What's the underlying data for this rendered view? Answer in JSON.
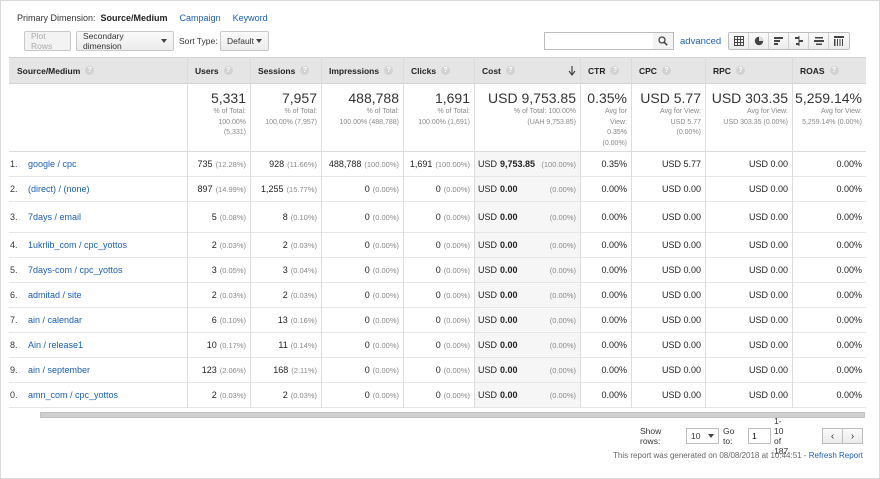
{
  "dimensions": {
    "label": "Primary Dimension:",
    "current": "Source/Medium",
    "links": [
      "Campaign",
      "Keyword"
    ]
  },
  "toolbar": {
    "plot_rows": "Plot Rows",
    "secondary_dimension": "Secondary dimension",
    "sort_type_label": "Sort Type:",
    "sort_type_value": "Default",
    "advanced": "advanced",
    "search_placeholder": ""
  },
  "columns": {
    "source": "Source/Medium",
    "users": "Users",
    "sessions": "Sessions",
    "impressions": "Impressions",
    "clicks": "Clicks",
    "cost": "Cost",
    "ctr": "CTR",
    "cpc": "CPC",
    "rpc": "RPC",
    "roas": "ROAS"
  },
  "totals": {
    "users": {
      "value": "5,331",
      "sub1": "% of Total:",
      "sub2": "100.00%",
      "sub3": "(5,331)"
    },
    "sessions": {
      "value": "7,957",
      "sub1": "% of Total:",
      "sub2": "100.00% (7,957)",
      "sub3": ""
    },
    "impressions": {
      "value": "488,788",
      "sub1": "% of Total:",
      "sub2": "100.00% (488,788)",
      "sub3": ""
    },
    "clicks": {
      "value": "1,691",
      "sub1": "% of Total:",
      "sub2": "100.00% (1,691)",
      "sub3": ""
    },
    "cost": {
      "value": "USD 9,753.85",
      "sub1": "% of Total: 100.00%",
      "sub2": "(UAH 9,753.85)",
      "sub3": ""
    },
    "ctr": {
      "value": "0.35%",
      "sub1": "Avg for",
      "sub2": "View:",
      "sub3": "0.35%",
      "sub4": "(0.00%)"
    },
    "cpc": {
      "value": "USD 5.77",
      "sub1": "Avg for View:",
      "sub2": "USD 5.77",
      "sub3": "(0.00%)"
    },
    "rpc": {
      "value": "USD 303.35",
      "sub1": "Avg for View:",
      "sub2": "USD 303.35 (0.00%)",
      "sub3": ""
    },
    "roas": {
      "value": "5,259.14%",
      "sub1": "Avg for View:",
      "sub2": "5,259.14% (0.00%)",
      "sub3": ""
    }
  },
  "rows": [
    {
      "idx": "1.",
      "source": "google / cpc",
      "users": "735",
      "users_pct": "(12.28%)",
      "sessions": "928",
      "sessions_pct": "(11.66%)",
      "impressions": "488,788",
      "impressions_pct": "(100.00%)",
      "clicks": "1,691",
      "clicks_pct": "(100.00%)",
      "cost_cur": "USD",
      "cost": "9,753.85",
      "cost_pct": "(100.00%)",
      "ctr": "0.35%",
      "cpc": "USD 5.77",
      "rpc": "USD 0.00",
      "roas": "0.00%"
    },
    {
      "idx": "2.",
      "source": "(direct) / (none)",
      "users": "897",
      "users_pct": "(14.99%)",
      "sessions": "1,255",
      "sessions_pct": "(15.77%)",
      "impressions": "0",
      "impressions_pct": "(0.00%)",
      "clicks": "0",
      "clicks_pct": "(0.00%)",
      "cost_cur": "USD",
      "cost": "0.00",
      "cost_pct": "(0.00%)",
      "ctr": "0.00%",
      "cpc": "USD 0.00",
      "rpc": "USD 0.00",
      "roas": "0.00%"
    },
    {
      "idx": "3.",
      "source": "7days / email",
      "users": "5",
      "users_pct": "(0.08%)",
      "sessions": "8",
      "sessions_pct": "(0.10%)",
      "impressions": "0",
      "impressions_pct": "(0.00%)",
      "clicks": "0",
      "clicks_pct": "(0.00%)",
      "cost_cur": "USD",
      "cost": "0.00",
      "cost_pct": "(0.00%)",
      "ctr": "0.00%",
      "cpc": "USD 0.00",
      "rpc": "USD 0.00",
      "roas": "0.00%"
    },
    {
      "idx": "4.",
      "source": "1ukrlib_com / cpc_yottos",
      "users": "2",
      "users_pct": "(0.03%)",
      "sessions": "2",
      "sessions_pct": "(0.03%)",
      "impressions": "0",
      "impressions_pct": "(0.00%)",
      "clicks": "0",
      "clicks_pct": "(0.00%)",
      "cost_cur": "USD",
      "cost": "0.00",
      "cost_pct": "(0.00%)",
      "ctr": "0.00%",
      "cpc": "USD 0.00",
      "rpc": "USD 0.00",
      "roas": "0.00%"
    },
    {
      "idx": "5.",
      "source": "7days-com / cpc_yottos",
      "users": "3",
      "users_pct": "(0.05%)",
      "sessions": "3",
      "sessions_pct": "(0.04%)",
      "impressions": "0",
      "impressions_pct": "(0.00%)",
      "clicks": "0",
      "clicks_pct": "(0.00%)",
      "cost_cur": "USD",
      "cost": "0.00",
      "cost_pct": "(0.00%)",
      "ctr": "0.00%",
      "cpc": "USD 0.00",
      "rpc": "USD 0.00",
      "roas": "0.00%"
    },
    {
      "idx": "6.",
      "source": "admitad / site",
      "users": "2",
      "users_pct": "(0.03%)",
      "sessions": "2",
      "sessions_pct": "(0.03%)",
      "impressions": "0",
      "impressions_pct": "(0.00%)",
      "clicks": "0",
      "clicks_pct": "(0.00%)",
      "cost_cur": "USD",
      "cost": "0.00",
      "cost_pct": "(0.00%)",
      "ctr": "0.00%",
      "cpc": "USD 0.00",
      "rpc": "USD 0.00",
      "roas": "0.00%"
    },
    {
      "idx": "7.",
      "source": "ain / calendar",
      "users": "6",
      "users_pct": "(0.10%)",
      "sessions": "13",
      "sessions_pct": "(0.16%)",
      "impressions": "0",
      "impressions_pct": "(0.00%)",
      "clicks": "0",
      "clicks_pct": "(0.00%)",
      "cost_cur": "USD",
      "cost": "0.00",
      "cost_pct": "(0.00%)",
      "ctr": "0.00%",
      "cpc": "USD 0.00",
      "rpc": "USD 0.00",
      "roas": "0.00%"
    },
    {
      "idx": "8.",
      "source": "Ain / release1",
      "users": "10",
      "users_pct": "(0.17%)",
      "sessions": "11",
      "sessions_pct": "(0.14%)",
      "impressions": "0",
      "impressions_pct": "(0.00%)",
      "clicks": "0",
      "clicks_pct": "(0.00%)",
      "cost_cur": "USD",
      "cost": "0.00",
      "cost_pct": "(0.00%)",
      "ctr": "0.00%",
      "cpc": "USD 0.00",
      "rpc": "USD 0.00",
      "roas": "0.00%"
    },
    {
      "idx": "9.",
      "source": "ain / september",
      "users": "123",
      "users_pct": "(2.06%)",
      "sessions": "168",
      "sessions_pct": "(2.11%)",
      "impressions": "0",
      "impressions_pct": "(0.00%)",
      "clicks": "0",
      "clicks_pct": "(0.00%)",
      "cost_cur": "USD",
      "cost": "0.00",
      "cost_pct": "(0.00%)",
      "ctr": "0.00%",
      "cpc": "USD 0.00",
      "rpc": "USD 0.00",
      "roas": "0.00%"
    },
    {
      "idx": "0.",
      "source": "amn_com / cpc_yottos",
      "users": "2",
      "users_pct": "(0.03%)",
      "sessions": "2",
      "sessions_pct": "(0.03%)",
      "impressions": "0",
      "impressions_pct": "(0.00%)",
      "clicks": "0",
      "clicks_pct": "(0.00%)",
      "cost_cur": "USD",
      "cost": "0.00",
      "cost_pct": "(0.00%)",
      "ctr": "0.00%",
      "cpc": "USD 0.00",
      "rpc": "USD 0.00",
      "roas": "0.00%"
    }
  ],
  "pager": {
    "show_rows_label": "Show rows:",
    "show_rows_value": "10",
    "goto_label": "Go to:",
    "goto_value": "1",
    "range": "1-10 of 187"
  },
  "footer": {
    "text": "This report was generated on 08/08/2018 at 10:44:51 -",
    "refresh": "Refresh Report"
  },
  "icons": {
    "search": "search-icon",
    "help": "help-circle-icon",
    "sort": "sort-desc-arrow-icon",
    "prev": "chevron-left-icon",
    "next": "chevron-right-icon"
  }
}
